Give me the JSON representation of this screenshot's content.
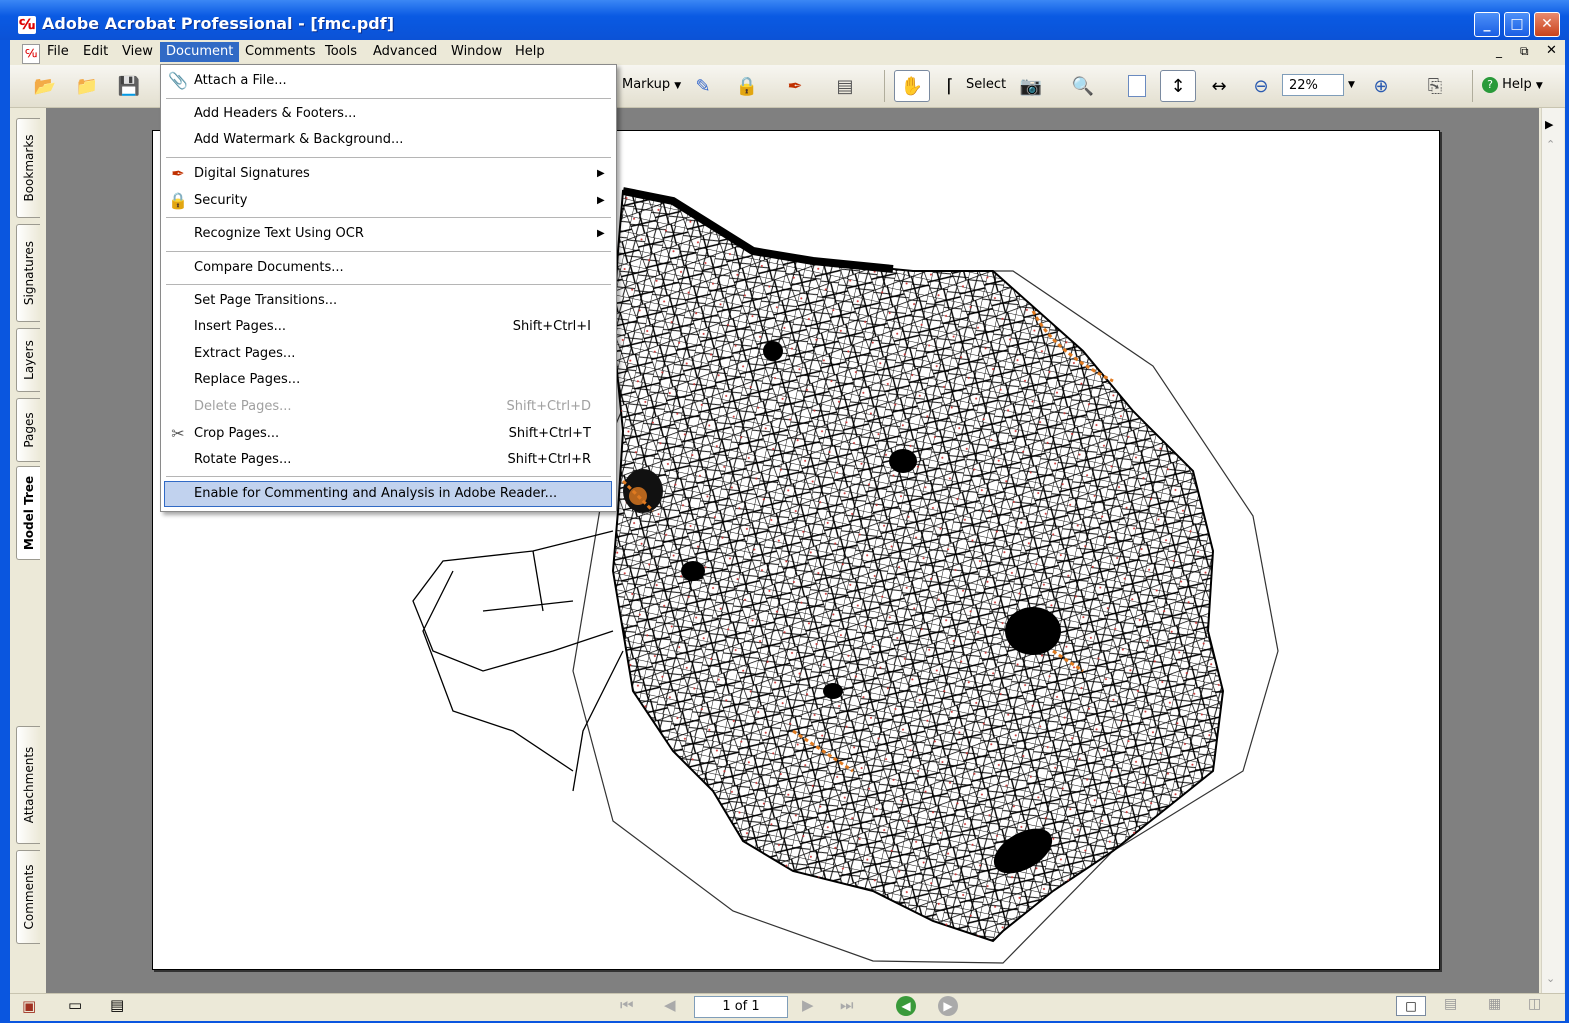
{
  "window": {
    "title": "Adobe Acrobat Professional - [fmc.pdf]"
  },
  "menubar": [
    "File",
    "Edit",
    "View",
    "Document",
    "Comments",
    "Tools",
    "Advanced",
    "Window",
    "Help"
  ],
  "toolbar": {
    "markup_label": "Markup",
    "select_label": "Select",
    "zoom_value": "22%",
    "help_label": "Help"
  },
  "navpane": {
    "tabs": [
      "Bookmarks",
      "Signatures",
      "Layers",
      "Pages",
      "Model Tree",
      "Attachments",
      "Comments"
    ]
  },
  "document_menu": {
    "items": [
      {
        "label": "Attach a File...",
        "shortcut": ""
      },
      {
        "label": "Add Headers & Footers...",
        "shortcut": ""
      },
      {
        "label": "Add Watermark & Background...",
        "shortcut": ""
      },
      {
        "label": "Digital Signatures",
        "shortcut": ""
      },
      {
        "label": "Security",
        "shortcut": ""
      },
      {
        "label": "Recognize Text Using OCR",
        "shortcut": ""
      },
      {
        "label": "Compare Documents...",
        "shortcut": ""
      },
      {
        "label": "Set Page Transitions...",
        "shortcut": ""
      },
      {
        "label": "Insert Pages...",
        "shortcut": "Shift+Ctrl+I"
      },
      {
        "label": "Extract Pages...",
        "shortcut": ""
      },
      {
        "label": "Replace Pages...",
        "shortcut": ""
      },
      {
        "label": "Delete Pages...",
        "shortcut": "Shift+Ctrl+D"
      },
      {
        "label": "Crop Pages...",
        "shortcut": "Shift+Ctrl+T"
      },
      {
        "label": "Rotate Pages...",
        "shortcut": "Shift+Ctrl+R"
      },
      {
        "label": "Enable for Commenting and Analysis in Adobe Reader...",
        "shortcut": ""
      }
    ]
  },
  "statusbar": {
    "page_indicator": "1 of 1"
  },
  "colors": {
    "titlebar": "#0a5ae3",
    "menu_highlight": "#316ac5",
    "chrome": "#ece9d8",
    "doc_bg": "#808080"
  }
}
